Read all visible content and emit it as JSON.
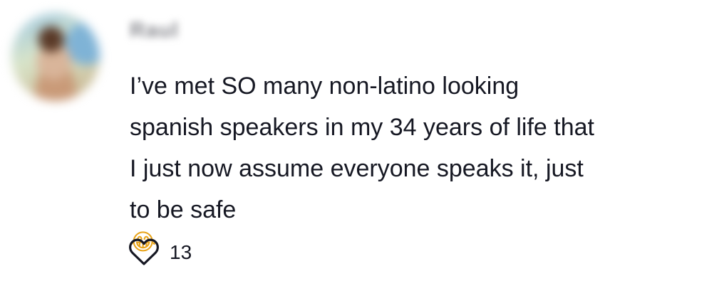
{
  "comment": {
    "username": "Raul",
    "text_lines": [
      "I’ve met SO many non-latino looking",
      "spanish speakers in my 34 years of life that",
      "I just now assume everyone speaks it, just",
      "to be safe"
    ],
    "emoji": "😂",
    "likes": "13",
    "icons": {
      "avatar": "avatar",
      "like": "heart-outline-icon"
    },
    "colors": {
      "text": "#161823",
      "icon": "#161823"
    }
  }
}
